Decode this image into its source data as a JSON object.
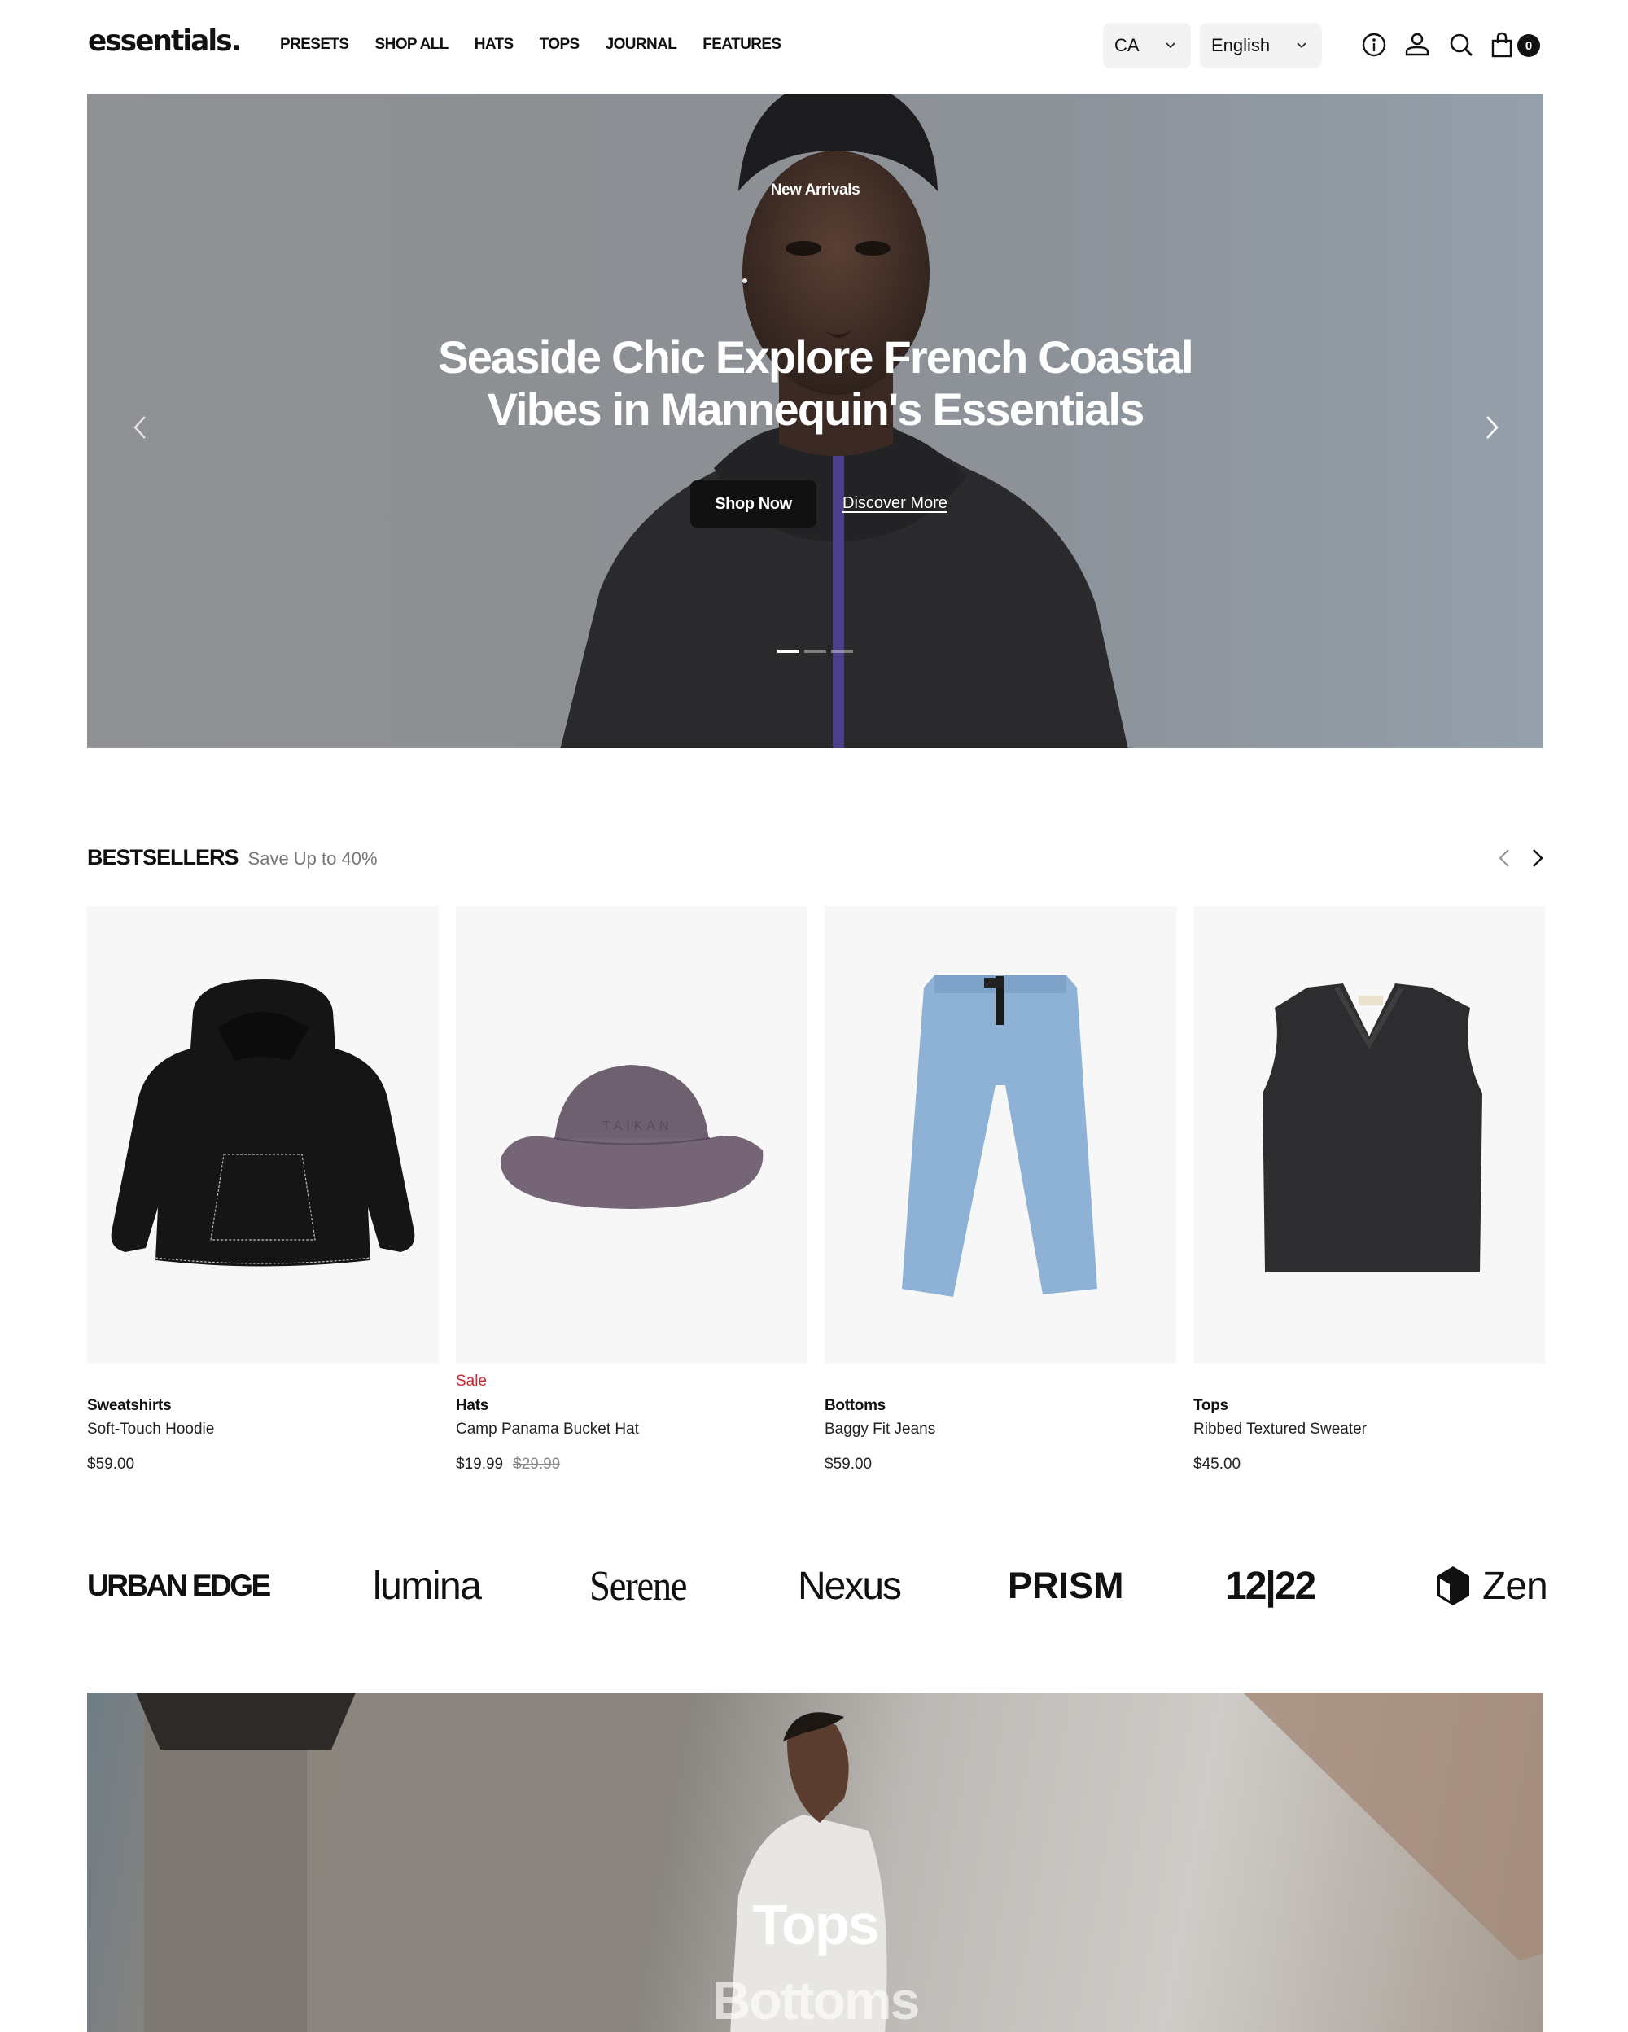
{
  "header": {
    "logo": "essentials.",
    "nav": [
      "PRESETS",
      "SHOP ALL",
      "HATS",
      "TOPS",
      "JOURNAL",
      "FEATURES"
    ],
    "country_select": {
      "value": "CA"
    },
    "language_select": {
      "value": "English"
    },
    "icons": [
      "info-icon",
      "account-icon",
      "search-icon",
      "cart-icon"
    ],
    "cart_count": "0"
  },
  "hero": {
    "eyebrow": "New Arrivals",
    "title": "Seaside Chic Explore French Coastal Vibes in Mannequin's Essentials",
    "primary_button": "Shop Now",
    "secondary_link": "Discover More",
    "slides_total": 3,
    "active_slide": 1
  },
  "bestsellers": {
    "title": "BESTSELLERS",
    "subtitle": "Save Up to 40%",
    "products": [
      {
        "category": "Sweatshirts",
        "name": "Soft-Touch Hoodie",
        "price": "$59.00",
        "sale": null,
        "compare_price": null,
        "image": "black hoodie"
      },
      {
        "category": "Hats",
        "name": "Camp Panama Bucket Hat",
        "price": "$19.99",
        "sale": "Sale",
        "compare_price": "$29.99",
        "image": "purple bucket hat",
        "image_text": "TAIKAN"
      },
      {
        "category": "Bottoms",
        "name": "Baggy Fit Jeans",
        "price": "$59.00",
        "sale": null,
        "compare_price": null,
        "image": "light blue jeans"
      },
      {
        "category": "Tops",
        "name": "Ribbed Textured Sweater",
        "price": "$45.00",
        "sale": null,
        "compare_price": null,
        "image": "charcoal sweater vest"
      }
    ]
  },
  "brands": [
    "URBAN EDGE",
    "lumina",
    "Serene",
    "Nexus",
    "PRISM",
    "12|22",
    "Zen"
  ],
  "categories": {
    "items": [
      "Tops",
      "Bottoms"
    ]
  },
  "colors": {
    "sale": "#d1242f",
    "primary": "#111111",
    "card_bg": "#f7f7f7",
    "select_bg": "#f3f3f3"
  }
}
